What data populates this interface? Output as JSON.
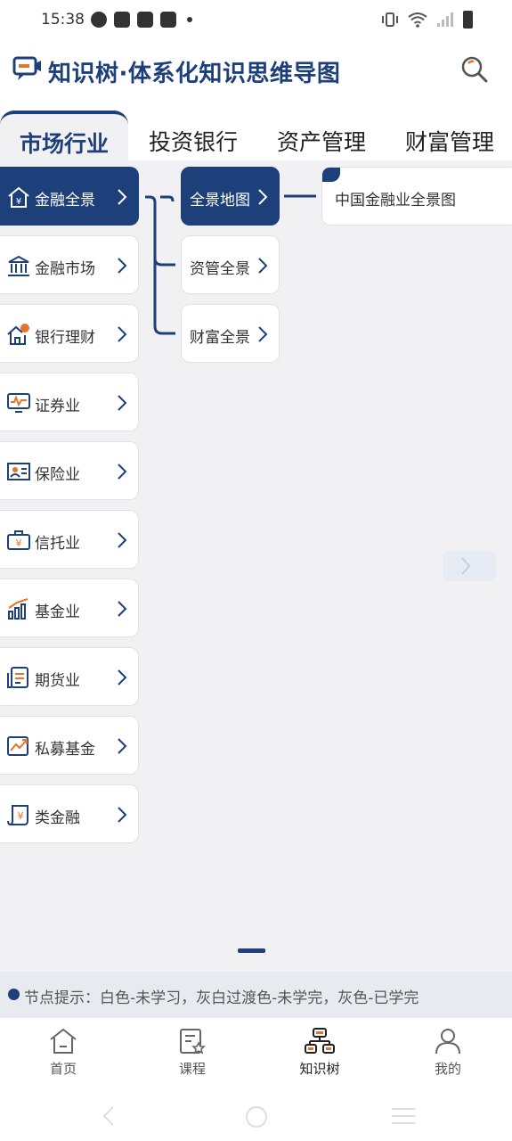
{
  "status_bar": {
    "time": "15:38"
  },
  "header": {
    "title": "知识树·体系化知识思维导图"
  },
  "tabs": [
    {
      "label": "市场行业",
      "active": true
    },
    {
      "label": "投资银行",
      "active": false
    },
    {
      "label": "资产管理",
      "active": false
    },
    {
      "label": "财富管理",
      "active": false
    }
  ],
  "level1": [
    {
      "label": "金融全景",
      "icon": "home-yen-icon",
      "selected": true
    },
    {
      "label": "金融市场",
      "icon": "bank-icon",
      "selected": false
    },
    {
      "label": "银行理财",
      "icon": "house-coin-icon",
      "selected": false
    },
    {
      "label": "证券业",
      "icon": "monitor-chart-icon",
      "selected": false
    },
    {
      "label": "保险业",
      "icon": "id-card-icon",
      "selected": false
    },
    {
      "label": "信托业",
      "icon": "briefcase-yen-icon",
      "selected": false
    },
    {
      "label": "基金业",
      "icon": "bar-chart-up-icon",
      "selected": false
    },
    {
      "label": "期货业",
      "icon": "document-list-icon",
      "selected": false
    },
    {
      "label": "私募基金",
      "icon": "trend-up-icon",
      "selected": false
    },
    {
      "label": "类金融",
      "icon": "scroll-yen-icon",
      "selected": false
    }
  ],
  "level2": [
    {
      "label": "全景地图",
      "selected": true
    },
    {
      "label": "资管全景",
      "selected": false
    },
    {
      "label": "财富全景",
      "selected": false
    }
  ],
  "level3": [
    {
      "label": "中国金融业全景图"
    }
  ],
  "hint": {
    "text": "节点提示：白色-未学习，灰白过渡色-未学完，灰色-已学完"
  },
  "bottom_nav": [
    {
      "label": "首页",
      "icon": "home-icon",
      "active": false
    },
    {
      "label": "课程",
      "icon": "course-icon",
      "active": false
    },
    {
      "label": "知识树",
      "icon": "tree-icon",
      "active": true
    },
    {
      "label": "我的",
      "icon": "profile-icon",
      "active": false
    }
  ],
  "colors": {
    "primary": "#1d3f7a",
    "accent": "#e8712c",
    "background": "#f1f1f4"
  }
}
